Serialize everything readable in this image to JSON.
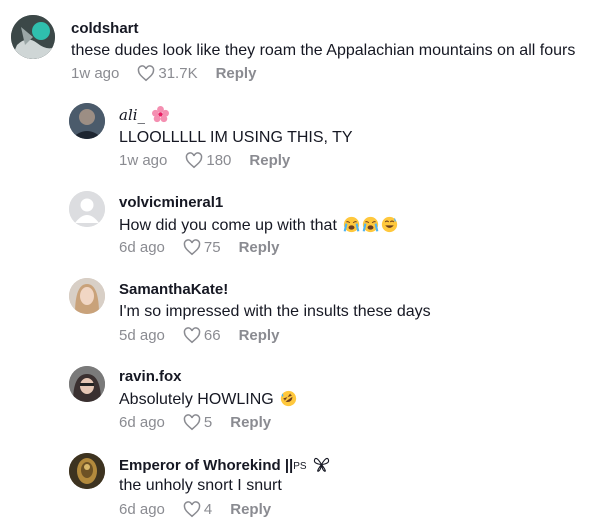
{
  "comments": [
    {
      "username": "coldshart",
      "text": "these dudes look like they roam the Appalachian mountains on all fours",
      "date": "1w ago",
      "likes": "31.7K",
      "reply_label": "Reply"
    },
    {
      "username": "ali_",
      "text": "LLOOLLLLL IM USING THIS, TY",
      "date": "1w ago",
      "likes": "180",
      "reply_label": "Reply"
    },
    {
      "username": "volvicmineral1",
      "text": "How did you come up with that",
      "date": "6d ago",
      "likes": "75",
      "reply_label": "Reply"
    },
    {
      "username": "SamanthaKate!",
      "text": "I'm so impressed with the insults these days",
      "date": "5d ago",
      "likes": "66",
      "reply_label": "Reply"
    },
    {
      "username": "ravin.fox",
      "text": "Absolutely HOWLING",
      "date": "6d ago",
      "likes": "5",
      "reply_label": "Reply"
    },
    {
      "username": "Emperor of Whorekind ||",
      "username_suffix": "PS",
      "text": "the unholy snort I snurt",
      "date": "6d ago",
      "likes": "4",
      "reply_label": "Reply"
    }
  ],
  "colors": {
    "text": "#161823",
    "muted": "#8a8b91"
  },
  "icons": [
    "heart-outline-icon",
    "cherry-blossom-icon",
    "crying-face-icon",
    "grinning-sweat-face-icon",
    "rolling-laughing-face-icon",
    "butterfly-icon"
  ]
}
